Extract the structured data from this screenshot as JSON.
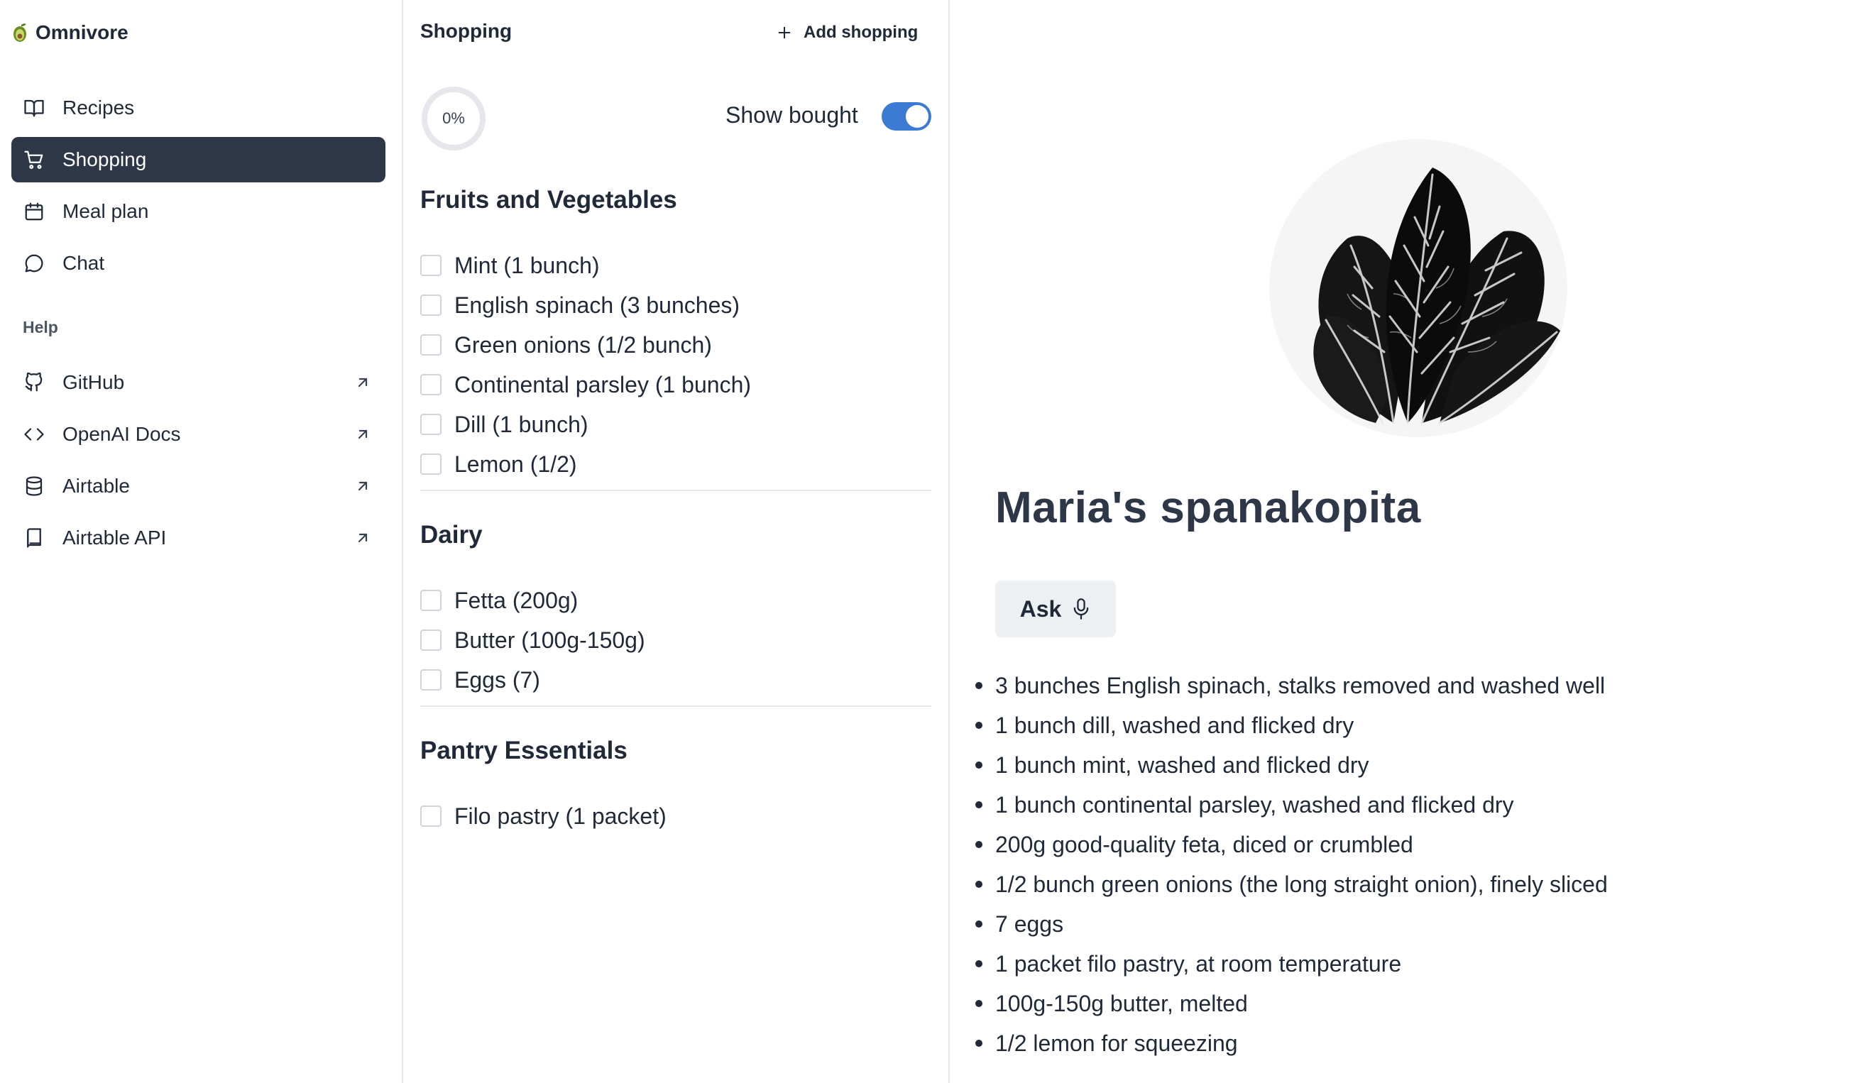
{
  "app": {
    "name": "Omnivore"
  },
  "sidebar": {
    "items": [
      {
        "label": "Recipes",
        "icon": "book-open-icon"
      },
      {
        "label": "Shopping",
        "icon": "shopping-cart-icon",
        "active": true
      },
      {
        "label": "Meal plan",
        "icon": "calendar-icon"
      },
      {
        "label": "Chat",
        "icon": "chat-bubble-icon"
      }
    ],
    "help_title": "Help",
    "help_items": [
      {
        "label": "GitHub",
        "icon": "github-icon",
        "external": true
      },
      {
        "label": "OpenAI Docs",
        "icon": "code-icon",
        "external": true
      },
      {
        "label": "Airtable",
        "icon": "database-icon",
        "external": true
      },
      {
        "label": "Airtable API",
        "icon": "book-icon",
        "external": true
      }
    ]
  },
  "shopping": {
    "title": "Shopping",
    "add_label": "Add shopping",
    "progress_text": "0%",
    "progress_value": 0,
    "show_bought_label": "Show bought",
    "show_bought_on": true,
    "sections": [
      {
        "title": "Fruits and Vegetables",
        "items": [
          "Mint (1 bunch)",
          "English spinach (3 bunches)",
          "Green onions (1/2 bunch)",
          "Continental parsley (1 bunch)",
          "Dill (1 bunch)",
          "Lemon (1/2)"
        ]
      },
      {
        "title": "Dairy",
        "items": [
          "Fetta (200g)",
          "Butter (100g-150g)",
          "Eggs (7)"
        ]
      },
      {
        "title": "Pantry Essentials",
        "items": [
          "Filo pastry (1 packet)"
        ]
      }
    ]
  },
  "recipe": {
    "title": "Maria's spanakopita",
    "ask_label": "Ask",
    "ingredients": [
      "3 bunches English spinach, stalks removed and washed well",
      "1 bunch dill, washed and flicked dry",
      "1 bunch mint, washed and flicked dry",
      "1 bunch continental parsley, washed and flicked dry",
      "200g good-quality feta, diced or crumbled",
      "1/2 bunch green onions (the long straight onion), finely sliced",
      "7 eggs",
      "1 packet filo pastry, at room temperature",
      "100g-150g butter, melted",
      "1/2 lemon for squeezing"
    ]
  },
  "colors": {
    "accent": "#3b7bd4",
    "active_nav": "#2d3748",
    "border": "#e5e7eb"
  }
}
